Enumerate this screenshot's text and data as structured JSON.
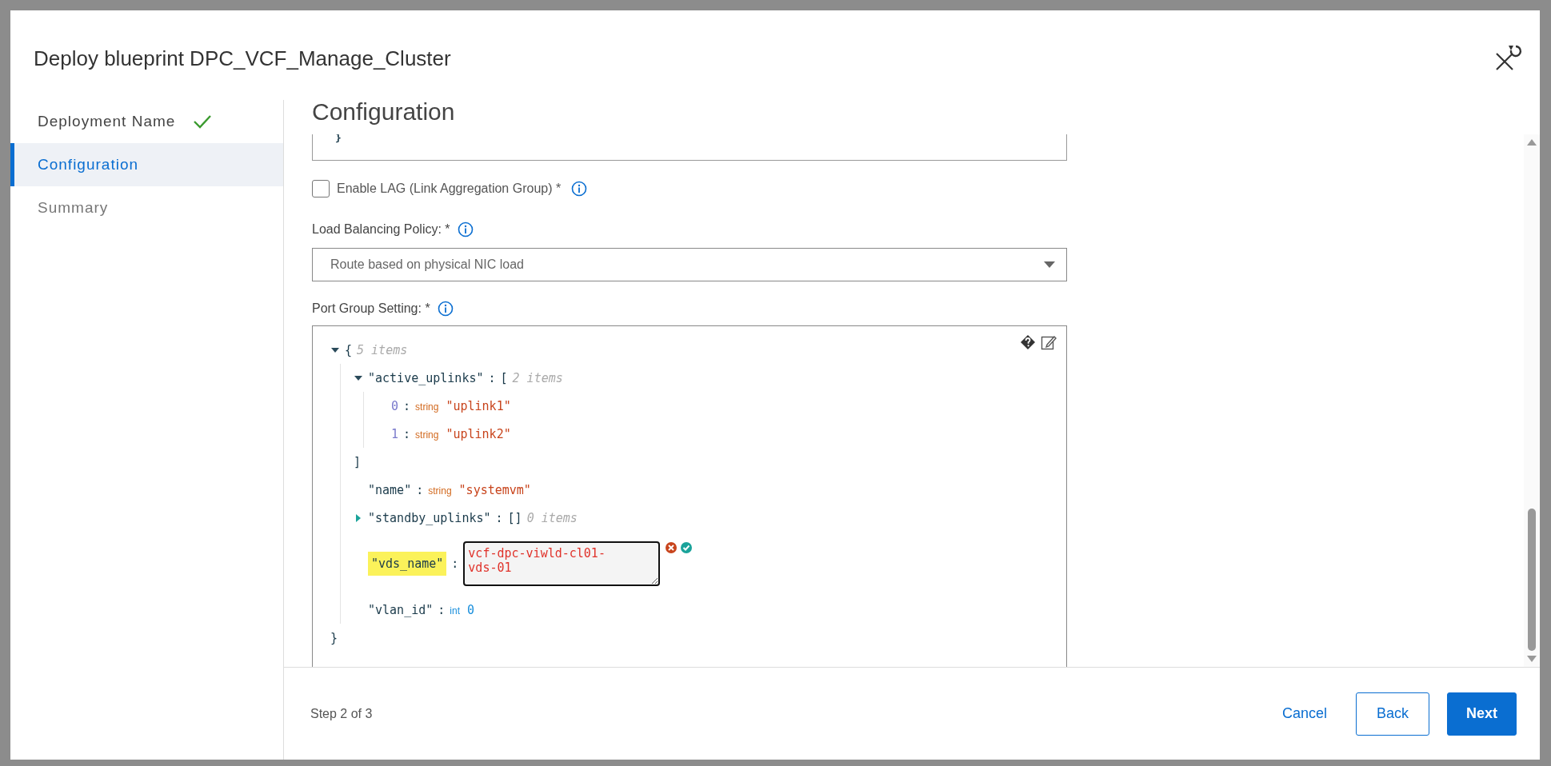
{
  "dialog": {
    "title": "Deploy blueprint DPC_VCF_Manage_Cluster"
  },
  "steps": [
    {
      "label": "Deployment Name",
      "selected": false,
      "done": true
    },
    {
      "label": "Configuration",
      "selected": true,
      "done": false
    },
    {
      "label": "Summary",
      "selected": false,
      "done": false
    }
  ],
  "content": {
    "heading": "Configuration",
    "previous_field_tail": "}",
    "lag": {
      "label": "Enable LAG (Link Aggregation Group) *",
      "checked": false
    },
    "load_balancing": {
      "label": "Load Balancing Policy: *",
      "value": "Route based on physical NIC load"
    },
    "port_group": {
      "label": "Port Group Setting: *",
      "editor": {
        "separator": ":",
        "root": {
          "open": "{",
          "count": "5 items",
          "expanded": true,
          "close": "}",
          "children": [
            {
              "kind": "array",
              "key": "\"active_uplinks\"",
              "open": "[",
              "count": "2 items",
              "expanded": true,
              "close": "]",
              "children": [
                {
                  "kind": "value",
                  "key": "0",
                  "index": true,
                  "type": "string",
                  "value": "\"uplink1\""
                },
                {
                  "kind": "value",
                  "key": "1",
                  "index": true,
                  "type": "string",
                  "value": "\"uplink2\""
                }
              ]
            },
            {
              "kind": "value",
              "key": "\"name\"",
              "index": false,
              "type": "string",
              "value": "\"systemvm\""
            },
            {
              "kind": "array",
              "key": "\"standby_uplinks\"",
              "open": "[]",
              "count": "0 items",
              "expanded": false
            },
            {
              "kind": "editing",
              "key": "\"vds_name\"",
              "highlighted": true,
              "value": "vcf-dpc-viwld-cl01-vds-01"
            },
            {
              "kind": "value",
              "key": "\"vlan_id\"",
              "index": false,
              "type": "int",
              "value": "0"
            }
          ]
        }
      }
    }
  },
  "footer": {
    "step": "Step 2 of 3",
    "buttons": [
      {
        "label": "Cancel",
        "kind": "link"
      },
      {
        "label": "Back",
        "kind": "outline"
      },
      {
        "label": "Next",
        "kind": "primary"
      }
    ]
  }
}
